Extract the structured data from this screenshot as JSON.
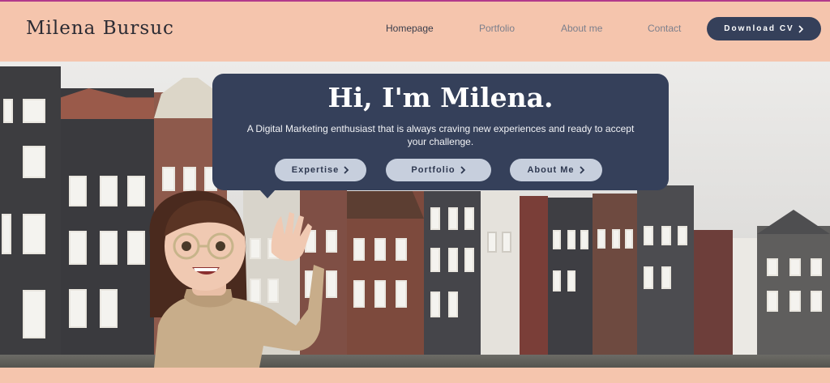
{
  "header": {
    "brand": "Milena Bursuc",
    "nav": [
      {
        "label": "Homepage",
        "active": true
      },
      {
        "label": "Portfolio",
        "active": false
      },
      {
        "label": "About me",
        "active": false
      },
      {
        "label": "Contact",
        "active": false
      }
    ],
    "cv_button": "Download CV",
    "cv_icon": "chevron-right-icon"
  },
  "hero": {
    "title": "Hi, I'm Milena.",
    "subtitle": "A Digital Marketing enthusiast that is always craving new experiences and ready to accept your challenge.",
    "buttons": [
      {
        "label": "Expertise",
        "icon": "chevron-right-icon"
      },
      {
        "label": "Portfolio",
        "icon": "chevron-right-icon"
      },
      {
        "label": "About Me",
        "icon": "chevron-right-icon"
      }
    ]
  },
  "colors": {
    "header_bg": "#f5c5ad",
    "accent_navy": "#35405a",
    "pill_bg": "#c7cfdd",
    "top_stripe": "#b23a8c"
  }
}
